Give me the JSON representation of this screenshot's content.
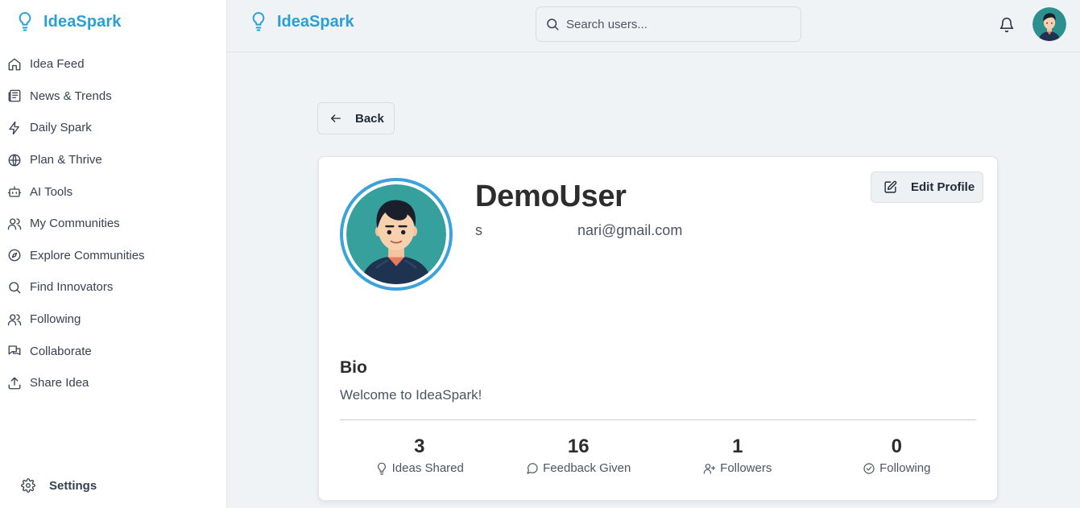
{
  "app": {
    "name": "IdeaSpark",
    "accent_color": "#2a9fd6"
  },
  "sidebar": {
    "items": [
      {
        "label": "Idea Feed",
        "icon": "home-icon"
      },
      {
        "label": "News & Trends",
        "icon": "newspaper-icon"
      },
      {
        "label": "Daily Spark",
        "icon": "zap-icon"
      },
      {
        "label": "Plan & Thrive",
        "icon": "globe-icon"
      },
      {
        "label": "AI Tools",
        "icon": "bot-icon"
      },
      {
        "label": "My Communities",
        "icon": "users-icon"
      },
      {
        "label": "Explore Communities",
        "icon": "compass-icon"
      },
      {
        "label": "Find Innovators",
        "icon": "search-icon"
      },
      {
        "label": "Following",
        "icon": "users-icon"
      },
      {
        "label": "Collaborate",
        "icon": "messages-icon"
      },
      {
        "label": "Share Idea",
        "icon": "upload-icon"
      }
    ],
    "settings_label": "Settings"
  },
  "header": {
    "search_placeholder": "Search users..."
  },
  "page": {
    "back_label": "Back",
    "profile": {
      "username": "DemoUser",
      "email_prefix": "s",
      "email_suffix": "nari@gmail.com",
      "edit_label": "Edit Profile",
      "bio_title": "Bio",
      "bio_text": "Welcome to IdeaSpark!"
    },
    "stats": [
      {
        "value": "3",
        "label": "Ideas Shared",
        "icon": "lightbulb-icon"
      },
      {
        "value": "16",
        "label": "Feedback Given",
        "icon": "message-circle-icon"
      },
      {
        "value": "1",
        "label": "Followers",
        "icon": "user-plus-icon"
      },
      {
        "value": "0",
        "label": "Following",
        "icon": "check-circle-icon"
      }
    ]
  }
}
